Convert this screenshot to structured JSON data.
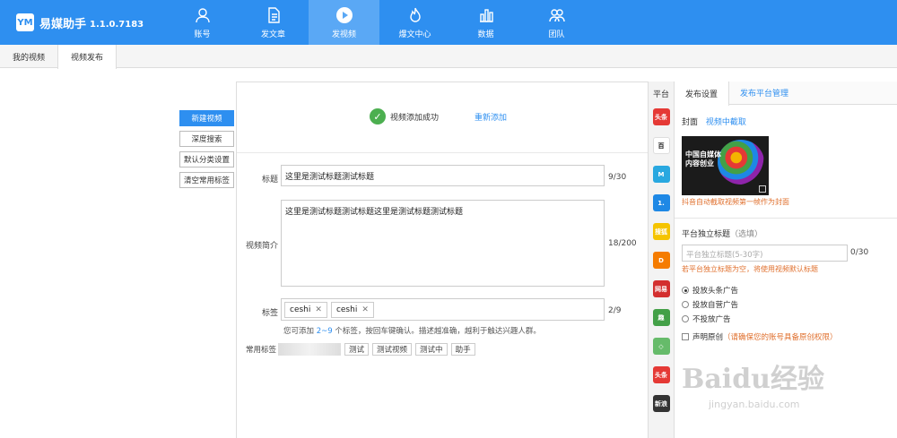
{
  "app": {
    "name": "易媒助手",
    "version": "1.1.0.7183",
    "logo_text": "YM"
  },
  "nav": [
    {
      "label": "账号",
      "icon": "user-icon"
    },
    {
      "label": "发文章",
      "icon": "document-icon"
    },
    {
      "label": "发视频",
      "icon": "play-icon",
      "active": true
    },
    {
      "label": "爆文中心",
      "icon": "flame-icon"
    },
    {
      "label": "数据",
      "icon": "bar-chart-icon"
    },
    {
      "label": "团队",
      "icon": "team-icon"
    }
  ],
  "tabs": [
    {
      "label": "我的视频"
    },
    {
      "label": "视频发布",
      "active": true
    }
  ],
  "left_buttons": [
    "新建视频",
    "深度搜索",
    "默认分类设置",
    "清空常用标签"
  ],
  "success": {
    "message": "视频添加成功",
    "readd": "重新添加"
  },
  "form": {
    "title_label": "标题",
    "title_value": "这里是测试标题测试标题",
    "title_count": "9/30",
    "desc_label": "视频简介",
    "desc_value": "这里是测试标题测试标题这里是测试标题测试标题",
    "desc_count": "18/200",
    "tags_label": "标签",
    "tags": [
      "ceshi",
      "ceshi"
    ],
    "tags_count": "2/9",
    "hint_prefix": "您可添加",
    "hint_range": "2~9",
    "hint_suffix": "个标签，按回车键确认。描述越准确，越利于触达兴趣人群。",
    "common_tags_label": "常用标签",
    "common_tags": [
      "测试",
      "测试视频",
      "测试中",
      "助手"
    ]
  },
  "platforms": {
    "title": "平台",
    "items": [
      {
        "name": "头条",
        "color": "#e53935"
      },
      {
        "name": "百",
        "color": "#ffffff"
      },
      {
        "name": "M",
        "color": "#29a8e0"
      },
      {
        "name": "1.",
        "color": "#1e88e5"
      },
      {
        "name": "搜狐",
        "color": "#f5c400"
      },
      {
        "name": "D",
        "color": "#f57c00"
      },
      {
        "name": "网易",
        "color": "#d32f2f"
      },
      {
        "name": "趣",
        "color": "#43a047"
      },
      {
        "name": "◇",
        "color": "#66bb6a"
      },
      {
        "name": "头条",
        "color": "#e53935"
      },
      {
        "name": "新浪",
        "color": "#333333"
      }
    ]
  },
  "right": {
    "tabs": [
      "发布设置",
      "发布平台管理"
    ],
    "cover_label": "封面",
    "cover_link": "视频中截取",
    "thumb_text": "中国自媒体\n内容创业",
    "cover_note": "抖音自动截取视频第一帧作为封面",
    "sub_title_label": "平台独立标题",
    "sub_title_opt": "（选填）",
    "sub_placeholder": "平台独立标题(5-30字)",
    "sub_count": "0/30",
    "sub_note": "若平台独立标题为空，将使用视频默认标题",
    "ads": [
      "投放头条广告",
      "投放自营广告",
      "不投放广告"
    ],
    "original_label": "声明原创",
    "original_warn": "（请确保您的账号具备原创权限）"
  },
  "watermark": {
    "main": "Baidu经验",
    "sub": "jingyan.baidu.com"
  }
}
